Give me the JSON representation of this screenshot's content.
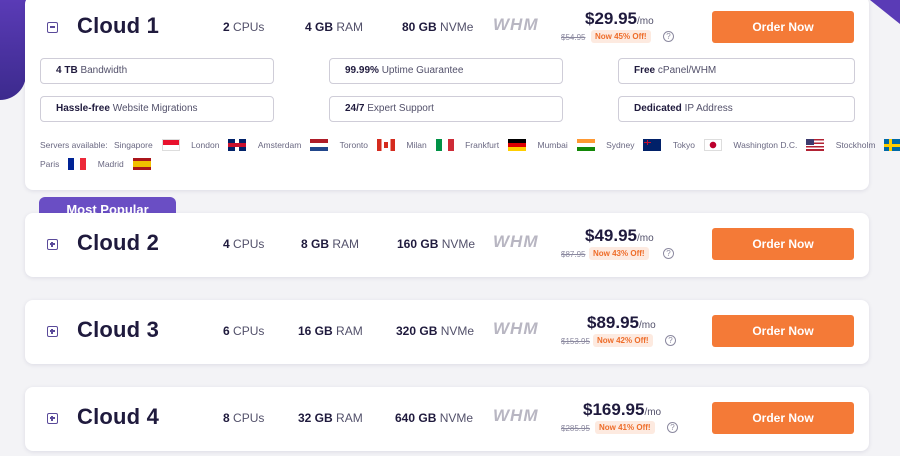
{
  "plans": [
    {
      "name": "Cloud 1",
      "expanded": true,
      "cpus_num": "2",
      "cpus_unit": "CPUs",
      "ram_num": "4 GB",
      "ram_unit": "RAM",
      "storage_num": "80 GB",
      "storage_unit": "NVMe",
      "panel_logo": "WHM",
      "price": "$29.95",
      "period": "/mo",
      "old_price": "$54.95",
      "discount": "Now 45% Off!",
      "order_label": "Order Now"
    },
    {
      "name": "Cloud 2",
      "expanded": false,
      "cpus_num": "4",
      "cpus_unit": "CPUs",
      "ram_num": "8 GB",
      "ram_unit": "RAM",
      "storage_num": "160 GB",
      "storage_unit": "NVMe",
      "panel_logo": "WHM",
      "price": "$49.95",
      "period": "/mo",
      "old_price": "$87.95",
      "discount": "Now 43% Off!",
      "order_label": "Order Now"
    },
    {
      "name": "Cloud 3",
      "expanded": false,
      "cpus_num": "6",
      "cpus_unit": "CPUs",
      "ram_num": "16 GB",
      "ram_unit": "RAM",
      "storage_num": "320 GB",
      "storage_unit": "NVMe",
      "panel_logo": "WHM",
      "price": "$89.95",
      "period": "/mo",
      "old_price": "$153.95",
      "discount": "Now 42% Off!",
      "order_label": "Order Now"
    },
    {
      "name": "Cloud 4",
      "expanded": false,
      "cpus_num": "8",
      "cpus_unit": "CPUs",
      "ram_num": "32 GB",
      "ram_unit": "RAM",
      "storage_num": "640 GB",
      "storage_unit": "NVMe",
      "panel_logo": "WHM",
      "price": "$169.95",
      "period": "/mo",
      "old_price": "$285.95",
      "discount": "Now 41% Off!",
      "order_label": "Order Now"
    }
  ],
  "features": [
    {
      "bold": "4 TB",
      "text": " Bandwidth"
    },
    {
      "bold": "99.99%",
      "text": " Uptime Guarantee"
    },
    {
      "bold": "Free",
      "text": " cPanel/WHM"
    },
    {
      "bold": "Hassle-free",
      "text": " Website Migrations"
    },
    {
      "bold": "24/7",
      "text": " Expert Support"
    },
    {
      "bold": "Dedicated",
      "text": " IP Address"
    }
  ],
  "servers_label": "Servers available:",
  "locations": [
    {
      "name": "Singapore",
      "flag": "sg"
    },
    {
      "name": "London",
      "flag": "uk"
    },
    {
      "name": "Amsterdam",
      "flag": "nl"
    },
    {
      "name": "Toronto",
      "flag": "ca"
    },
    {
      "name": "Milan",
      "flag": "it"
    },
    {
      "name": "Frankfurt",
      "flag": "de"
    },
    {
      "name": "Mumbai",
      "flag": "in"
    },
    {
      "name": "Sydney",
      "flag": "au"
    },
    {
      "name": "Tokyo",
      "flag": "jp"
    },
    {
      "name": "Washington D.C.",
      "flag": "us"
    },
    {
      "name": "Stockholm",
      "flag": "se"
    },
    {
      "name": "Paris",
      "flag": "fr"
    },
    {
      "name": "Madrid",
      "flag": "es"
    }
  ],
  "popular_badge": "Most Popular",
  "colors": {
    "accent": "#f47a37",
    "brand": "#6a4ec4",
    "text": "#1f1a3d",
    "discount_bg": "#fdeae0"
  }
}
